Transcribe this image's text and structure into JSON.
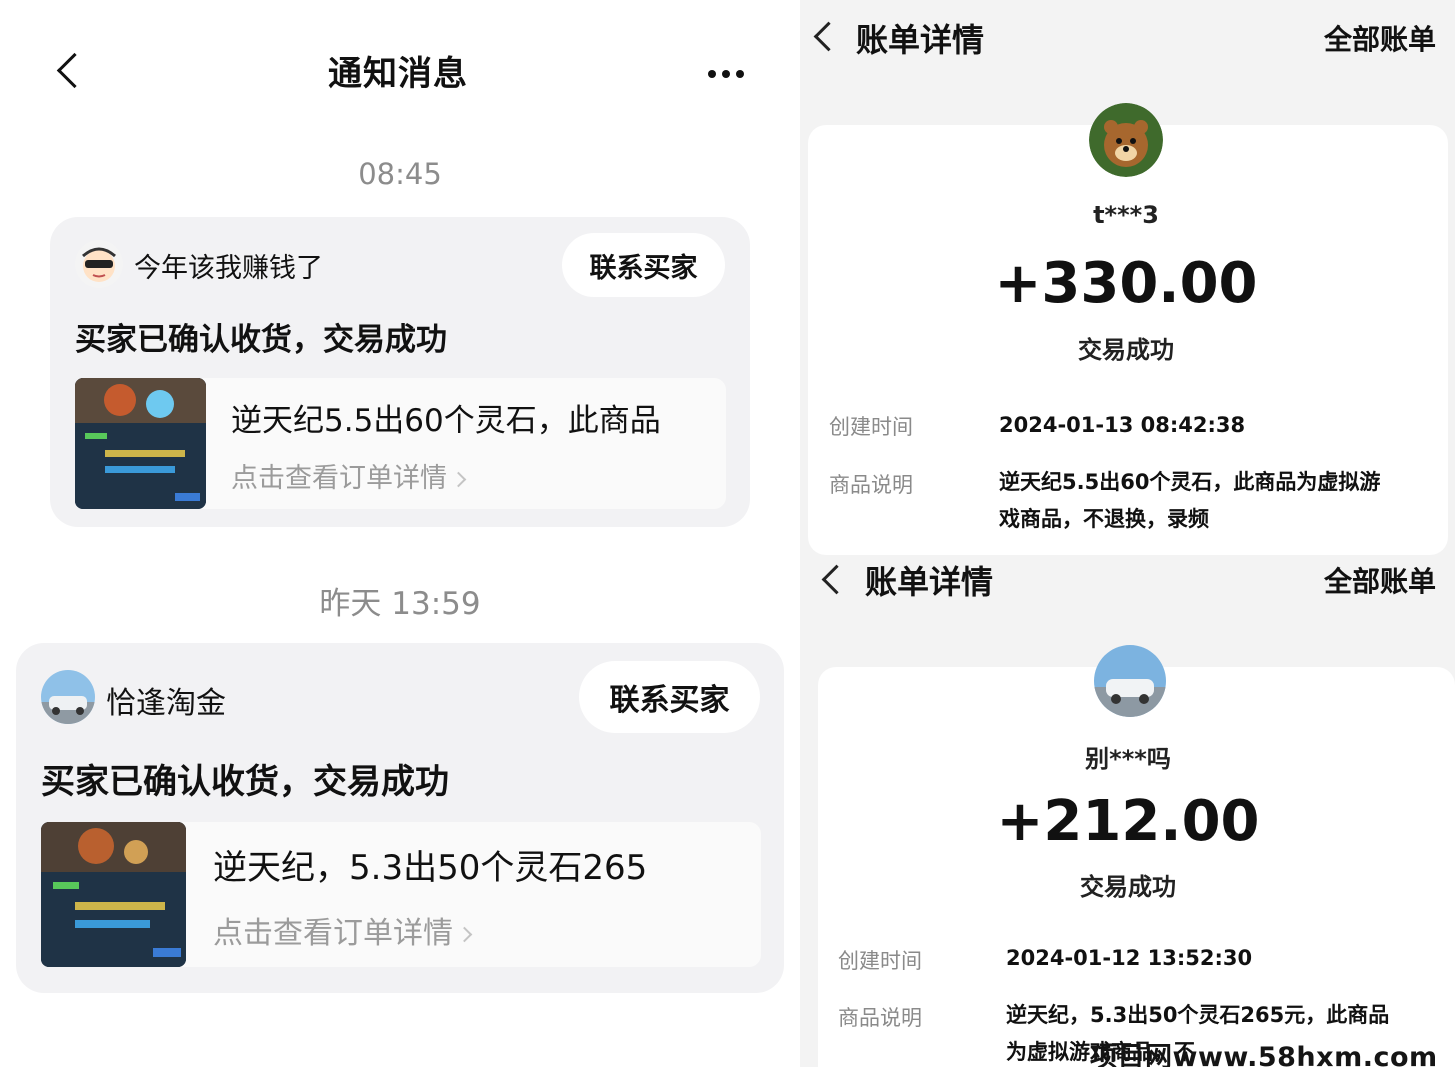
{
  "left": {
    "header": {
      "title": "通知消息"
    },
    "messages": [
      {
        "time": "08:45",
        "seller": "今年该我赚钱了",
        "contact_label": "联系买家",
        "status": "买家已确认收货，交易成功",
        "product": "逆天纪5.5出60个灵石，此商品",
        "link": "点击查看订单详情"
      },
      {
        "time": "昨天 13:59",
        "seller": "恰逢淘金",
        "contact_label": "联系买家",
        "status": "买家已确认收货，交易成功",
        "product": "逆天纪，5.3出50个灵石265",
        "link": "点击查看订单详情"
      }
    ]
  },
  "right": {
    "bills": [
      {
        "title": "账单详情",
        "all_label": "全部账单",
        "user": "t***3",
        "amount": "+330.00",
        "status": "交易成功",
        "created_label": "创建时间",
        "created_value": "2024-01-13 08:42:38",
        "desc_label": "商品说明",
        "desc_line1": "逆天纪5.5出60个灵石，此商品为虚拟游",
        "desc_line2": "戏商品，不退换，录频"
      },
      {
        "title": "账单详情",
        "all_label": "全部账单",
        "user": "别***吗",
        "amount": "+212.00",
        "status": "交易成功",
        "created_label": "创建时间",
        "created_value": "2024-01-12 13:52:30",
        "desc_label": "商品说明",
        "desc_line1": "逆天纪，5.3出50个灵石265元，此商品",
        "desc_line2": "为虚拟游戏商品，不"
      }
    ],
    "watermark": "项目网www.58hxm.com"
  },
  "icons": {
    "back": "back-chevron-icon",
    "more": "more-dots-icon",
    "arrow": "chevron-right-icon"
  }
}
